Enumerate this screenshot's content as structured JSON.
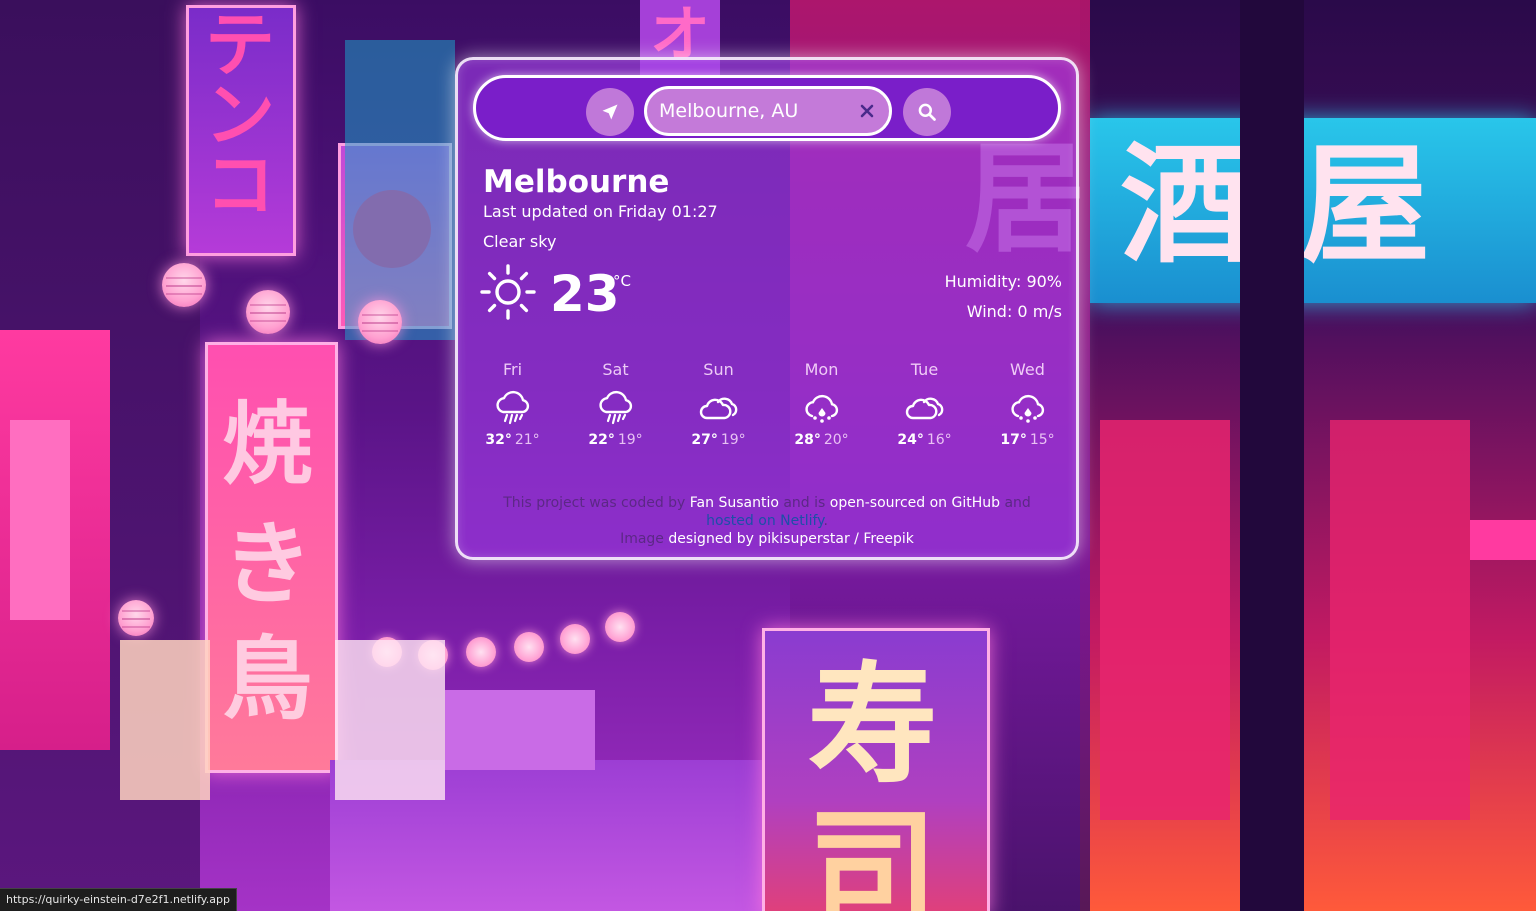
{
  "search": {
    "value": "Melbourne, AU",
    "locate_icon": "navigation-arrow-icon",
    "clear_icon": "close-icon",
    "search_icon": "magnifier-icon"
  },
  "current": {
    "city": "Melbourne",
    "last_updated": "Last updated on Friday 01:27",
    "condition": "Clear sky",
    "icon": "sun-icon",
    "temperature": "23",
    "unit": "°C",
    "humidity": "Humidity: 90%",
    "wind": "Wind: 0 m/s"
  },
  "forecast": [
    {
      "day": "Fri",
      "icon": "rain-cloud-icon",
      "high": "32°",
      "low": "21°"
    },
    {
      "day": "Sat",
      "icon": "rain-cloud-icon",
      "high": "22°",
      "low": "19°"
    },
    {
      "day": "Sun",
      "icon": "clouds-icon",
      "high": "27°",
      "low": "19°"
    },
    {
      "day": "Mon",
      "icon": "hail-cloud-icon",
      "high": "28°",
      "low": "20°"
    },
    {
      "day": "Tue",
      "icon": "clouds-icon",
      "high": "24°",
      "low": "16°"
    },
    {
      "day": "Wed",
      "icon": "hail-cloud-icon",
      "high": "17°",
      "low": "15°"
    }
  ],
  "credits": {
    "part1": "This project was coded by ",
    "author": "Fan Susantio",
    "part2": " and is ",
    "github": "open-sourced on GitHub",
    "part3": " and ",
    "netlify_prefix": "hosted on ",
    "netlify": "Netlify",
    "period": ".",
    "image_label": "Image ",
    "image_credit": "designed by pikisuperstar / Freepik"
  },
  "status_bar": {
    "url": "https://quirky-einstein-d7e2f1.netlify.app"
  },
  "background": {
    "kanji": [
      "テ",
      "ン",
      "コ",
      "焼",
      "き",
      "鳥",
      "居",
      "酒",
      "屋",
      "寿",
      "司",
      "オ"
    ]
  },
  "colors": {
    "card_bg": "#a03ce6",
    "search_bar": "#7a1ec9",
    "button": "#c078d9",
    "credits_text": "#5c2886",
    "link_blue": "#1c4fa8"
  }
}
